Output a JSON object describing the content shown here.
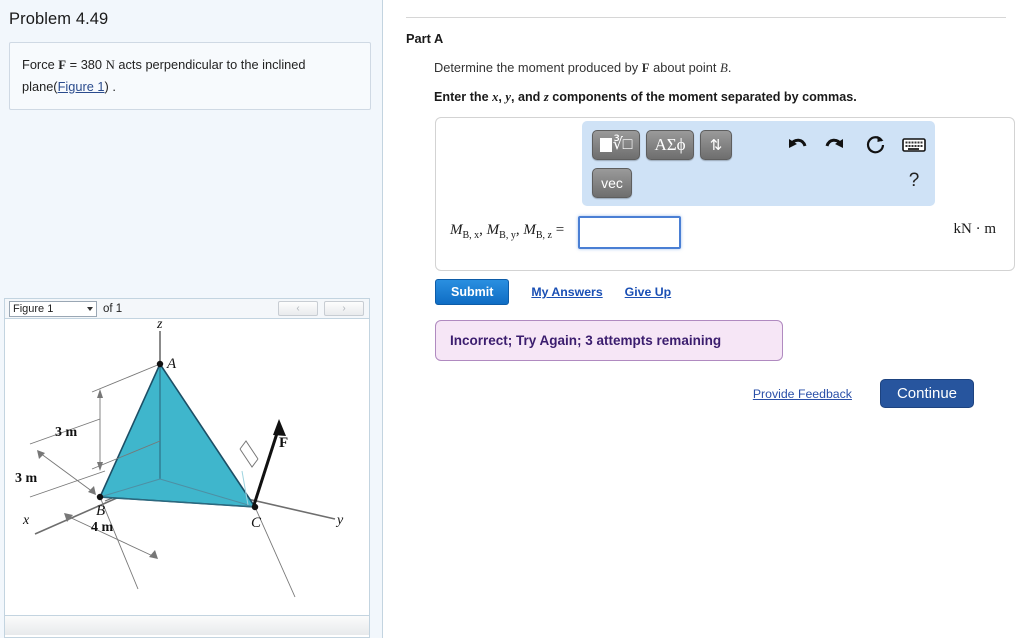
{
  "sidebar": {
    "problem_title": "Problem 4.49",
    "problem_statement": {
      "pre": "Force ",
      "force_symbol": "F",
      "mid": " = 380 ",
      "unit": "N",
      "post": " acts perpendicular to the inclined plane(",
      "figure_link": "Figure 1",
      "tail": ") ."
    },
    "figure_nav": {
      "selected_figure": "Figure 1",
      "count_label": "of 1",
      "prev_label": "‹",
      "next_label": "›"
    },
    "figure": {
      "axis_labels": {
        "x": "x",
        "y": "y",
        "z": "z"
      },
      "points": {
        "a": "A",
        "b": "B",
        "c": "C"
      },
      "force_label": "F",
      "dim_vertical": "3 m",
      "dim_x": "3 m",
      "dim_y": "4 m",
      "plane_color": "#3fb6cc"
    }
  },
  "main": {
    "part_label": "Part A",
    "question": {
      "pre": "Determine the moment produced by ",
      "force_symbol": "F",
      "mid": " about point ",
      "point": "B",
      "post": "."
    },
    "instruction": {
      "pre": "Enter the ",
      "x": "x",
      "comma1": ", ",
      "y": "y",
      "comma2": ", and ",
      "z": "z",
      "post": " components of the moment separated by commas."
    },
    "mathbar": {
      "template_button": "template-button",
      "greek_button": "ΑΣϕ",
      "updown_button": "⇅",
      "vec_button": "vec",
      "undo_icon": "undo-icon",
      "redo_icon": "redo-icon",
      "reset_icon": "reset-icon",
      "keyboard_icon": "keyboard-icon",
      "help_label": "?"
    },
    "answer": {
      "label_m": "M",
      "sub_bx": "B, x",
      "sub_by": "B, y",
      "sub_bz": "B, z",
      "equals": "=",
      "value": "",
      "placeholder": "",
      "units": "kN · m"
    },
    "actions": {
      "submit_label": "Submit",
      "my_answers_label": "My Answers",
      "give_up_label": "Give Up",
      "provide_feedback_label": "Provide Feedback",
      "continue_label": "Continue"
    },
    "feedback_banner": {
      "text": "Incorrect; Try Again; 3 attempts remaining",
      "bg_color": "#f6e6f6",
      "border_color": "#b08ac0",
      "text_color": "#3b1d6e"
    }
  }
}
